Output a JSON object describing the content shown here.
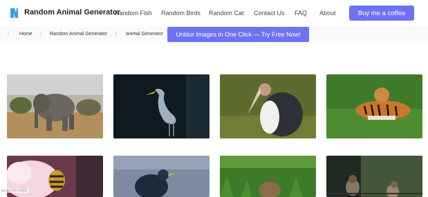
{
  "header": {
    "brand": "Random Animal Generator",
    "nav": [
      "Random Fish",
      "Random Birds",
      "Random Cat",
      "Contact Us",
      "FAQ",
      "About"
    ],
    "cta": "Buy me a coffee",
    "accent_color": "#6f72f2"
  },
  "breadcrumb": {
    "items": [
      "Home",
      "Random Animal Generator",
      "animal Generator"
    ],
    "separator": "/",
    "promo": "Unblur Images in One Click — Try Free Now!"
  },
  "gallery": {
    "images": [
      {
        "subject": "elephant"
      },
      {
        "subject": "heron"
      },
      {
        "subject": "marabou-stork"
      },
      {
        "subject": "tiger"
      },
      {
        "subject": "wasp-on-flower"
      },
      {
        "subject": "starling"
      },
      {
        "subject": "rabbit-in-grass"
      },
      {
        "subject": "sparrows"
      }
    ]
  },
  "status": {
    "watermark": "javascript:void(0)"
  }
}
